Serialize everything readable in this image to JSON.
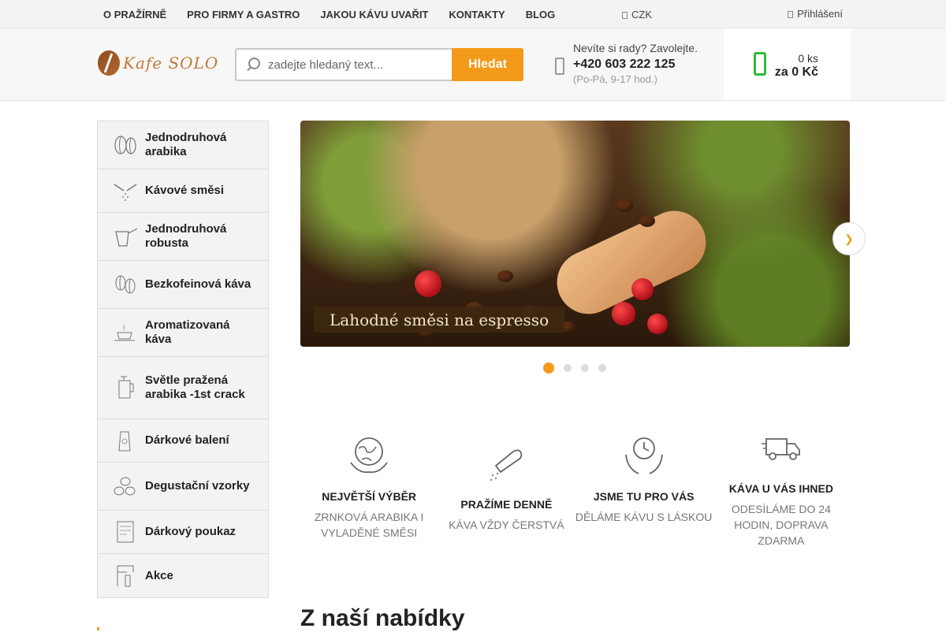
{
  "topnav": {
    "items": [
      "O PRAŽÍRNĚ",
      "PRO FIRMY A GASTRO",
      "JAKOU KÁVU UVAŘIT",
      "KONTAKTY",
      "BLOG"
    ],
    "currency": "CZK",
    "login": "Přihlášení"
  },
  "header": {
    "logo_text": "Kafe SOLO",
    "search_placeholder": "zadejte hledaný text...",
    "search_button": "Hledat",
    "contact_question": "Nevíte si rady? Zavolejte.",
    "contact_phone": "+420 603 222 125",
    "contact_hours": "(Po-Pá, 9-17 hod.)",
    "cart_count": "0 ks",
    "cart_total": "za 0 Kč"
  },
  "sidebar": {
    "items": [
      {
        "label": "Jednodruhová arabika",
        "icon": "coffee-beans-icon"
      },
      {
        "label": "Kávové směsi",
        "icon": "coffee-blend-icon"
      },
      {
        "label": "Jednodruhová robusta",
        "icon": "cezve-icon"
      },
      {
        "label": "Bezkofeinová káva",
        "icon": "decaf-icon"
      },
      {
        "label": "Aromatizovaná káva",
        "icon": "cup-icon"
      },
      {
        "label": "Světle pražená arabika -1st crack",
        "icon": "french-press-icon"
      },
      {
        "label": "Dárkové balení",
        "icon": "gift-bag-icon"
      },
      {
        "label": "Degustační vzorky",
        "icon": "samples-icon"
      },
      {
        "label": "Dárkový poukaz",
        "icon": "voucher-icon"
      },
      {
        "label": "Akce",
        "icon": "sale-icon"
      }
    ]
  },
  "banner": {
    "caption": "Lahodné směsi na espresso",
    "slides": 4,
    "active_slide": 1
  },
  "features": [
    {
      "title": "NEJVĚTŠÍ VÝBĚR",
      "subtitle": "ZRNKOVÁ ARABIKA I VYLADĚNÉ SMĚSI",
      "icon": "globe-hands-icon"
    },
    {
      "title": "PRAŽÍME DENNĚ",
      "subtitle": "KÁVA VŽDY ČERSTVÁ",
      "icon": "scoop-icon"
    },
    {
      "title": "JSME TU PRO VÁS",
      "subtitle": "DĚLÁME KÁVU S LÁSKOU",
      "icon": "clock-hands-icon"
    },
    {
      "title": "KÁVA U VÁS IHNED",
      "subtitle": "ODESÍLÁME DO 24 HODIN, DOPRAVA ZDARMA",
      "icon": "delivery-truck-icon"
    }
  ],
  "section_title": "Z naší nabídky",
  "colors": {
    "accent": "#f39a1a",
    "cart_green": "#2fbb3b"
  }
}
